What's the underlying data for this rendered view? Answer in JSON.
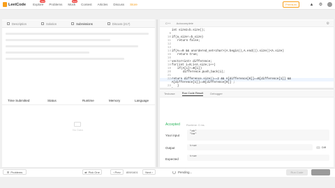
{
  "nav": {
    "logo": "LeetCode",
    "items": [
      {
        "label": "Explore",
        "badge": "New"
      },
      {
        "label": "Problems",
        "badge": ""
      },
      {
        "label": "Mock",
        "badge": "New"
      },
      {
        "label": "Contest",
        "badge": ""
      },
      {
        "label": "Articles",
        "badge": ""
      },
      {
        "label": "Discuss",
        "badge": ""
      },
      {
        "label": "Store",
        "badge": ""
      }
    ],
    "premium": "Premium"
  },
  "left": {
    "tabs": [
      "Description",
      "Solution",
      "Submissions",
      "Discuss (217)"
    ],
    "table_headers": [
      "Time Submitted",
      "Status",
      "Runtime",
      "Memory",
      "Language"
    ],
    "empty_text": "No Data"
  },
  "editor": {
    "language": "C++",
    "autocomplete": "Autocomplete",
    "lines": [
      {
        "n": "",
        "t": "int size2=b.size();"
      },
      {
        "n": "9",
        "t": ""
      },
      {
        "n": "10",
        "t": "if(a_size!=b_size)"
      },
      {
        "n": "11",
        "t": "    return false;"
      },
      {
        "n": "12",
        "t": ""
      },
      {
        "n": "13",
        "t": ""
      },
      {
        "n": "14",
        "t": "if(A==B && unordered_set<char>(A.begin(),A.end()).size()<A.size)"
      },
      {
        "n": "15",
        "t": "    return true;"
      },
      {
        "n": "16",
        "t": ""
      },
      {
        "n": "17",
        "t": "vector<int> difference;"
      },
      {
        "n": "18",
        "t": "for(int i=0;i<A.size;i++)"
      },
      {
        "n": "19",
        "t": "    if(A[i]!=B[i])"
      },
      {
        "n": "20",
        "t": "        difference.push_back(i);"
      },
      {
        "n": "21",
        "t": ""
      },
      {
        "n": "22",
        "t": "return difference.size()==2 && A[difference[0]]==B[difference[1]] &&"
      },
      {
        "n": "",
        "t": "A[difference[1]]==B[difference[0]] ;"
      },
      {
        "n": "23",
        "t": "    }"
      },
      {
        "n": "24",
        "t": "};"
      }
    ]
  },
  "console": {
    "tabs": [
      "Testcase",
      "Run Code Result",
      "Debugger"
    ],
    "status": "Accepted",
    "runtime": "Runtime: 0 ms",
    "your_input_label": "Your input",
    "your_input": [
      "\"ab\"",
      "\"ba\""
    ],
    "output_label": "Output",
    "output": "true",
    "expected_label": "Expected",
    "expected": "true",
    "diff_label": "Diff"
  },
  "bottom": {
    "problems": "Problems",
    "pick_one": "Pick One",
    "prev": "Prev",
    "page": "859/1601",
    "next": "Next",
    "pending": "Pending...",
    "run_code": "Run Code",
    "submit": ""
  },
  "colors": {
    "accent": "#f89f1b",
    "accepted": "#2db55d"
  }
}
